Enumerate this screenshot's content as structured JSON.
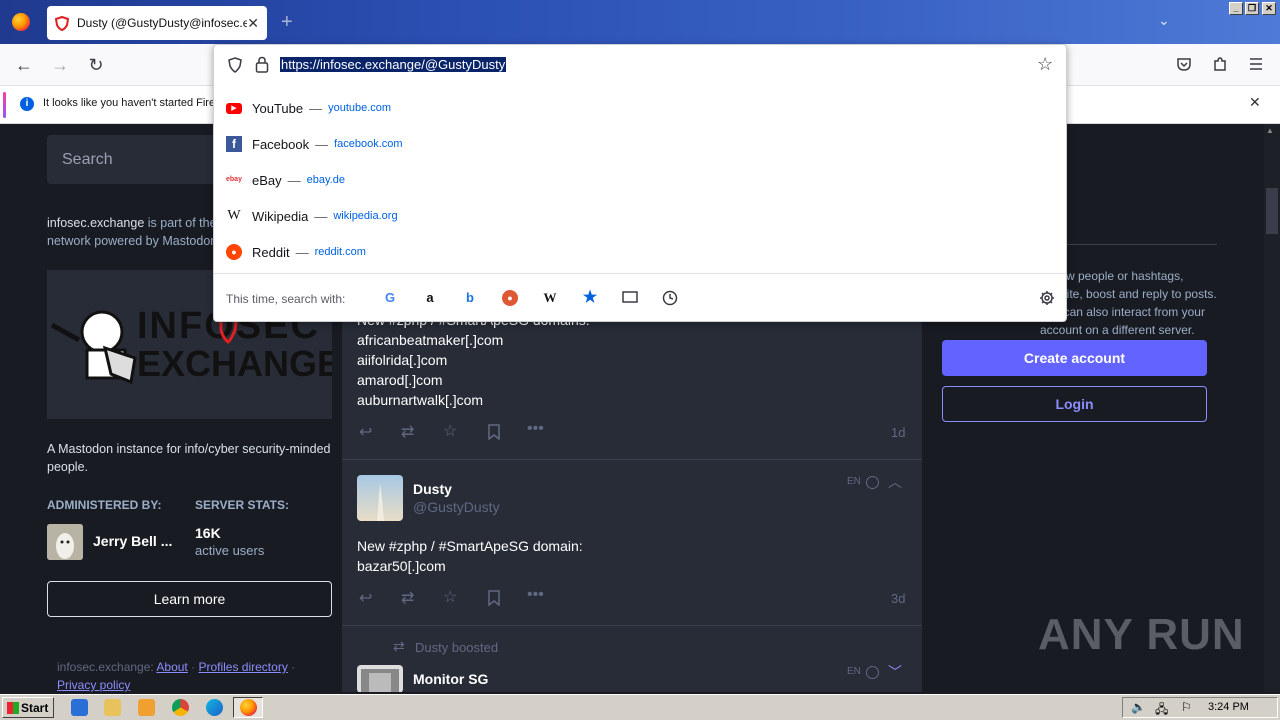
{
  "browser": {
    "tab_title": "Dusty (@GustyDusty@infosec.exchange)",
    "url": "https://infosec.exchange/@GustyDusty",
    "notification": "It looks like you haven't started Firefox in a while. Do you want to clean it up for a fresh, like-new experience?",
    "suggestions": [
      {
        "title": "YouTube",
        "sep": "—",
        "url": "youtube.com"
      },
      {
        "title": "Facebook",
        "sep": "—",
        "url": "facebook.com"
      },
      {
        "title": "eBay",
        "sep": "—",
        "url": "ebay.de"
      },
      {
        "title": "Wikipedia",
        "sep": "—",
        "url": "wikipedia.org"
      },
      {
        "title": "Reddit",
        "sep": "—",
        "url": "reddit.com"
      }
    ],
    "search_with_label": "This time, search with:"
  },
  "left": {
    "search_placeholder": "Search",
    "about_domain": "infosec.exchange",
    "about_rest": " is part of the decentralized social network powered by Mastodon.",
    "logo_top": "INFOSEC",
    "logo_bottom": "EXCHANGE",
    "server_description": "A Mastodon instance for info/cyber security-minded people.",
    "administered_by_label": "ADMINISTERED BY:",
    "server_stats_label": "SERVER STATS:",
    "admin_name": "Jerry Bell ...",
    "stat_value": "16K",
    "stat_label": "active users",
    "learn_more": "Learn more",
    "footer_site": "infosec.exchange:",
    "footer_about": "About",
    "footer_dot": "·",
    "footer_profiles": "Profiles directory",
    "footer_privacy": "Privacy policy"
  },
  "timeline": {
    "post1": {
      "header_line": "New #zphp / #SmartApeSG domains:",
      "lines": [
        "africanbeatmaker[.]com",
        "aiifolrida[.]com",
        "amarod[.]com",
        "auburnartwalk[.]com"
      ],
      "time": "1d"
    },
    "post2": {
      "name": "Dusty",
      "handle": "@GustyDusty",
      "lang": "EN",
      "line1": "New #zphp / #SmartApeSG domain:",
      "line2": "bazar50[.]com",
      "time": "3d"
    },
    "post3": {
      "boosted_by": "Dusty boosted",
      "name": "Monitor SG",
      "lang": "EN"
    }
  },
  "right": {
    "signup_text": "Follow people or hashtags, favorite, boost and reply to posts. You can also interact from your account on a different server.",
    "create_account": "Create account",
    "login": "Login",
    "watermark": "ANY RUN"
  },
  "taskbar": {
    "start": "Start",
    "clock": "3:24 PM"
  }
}
